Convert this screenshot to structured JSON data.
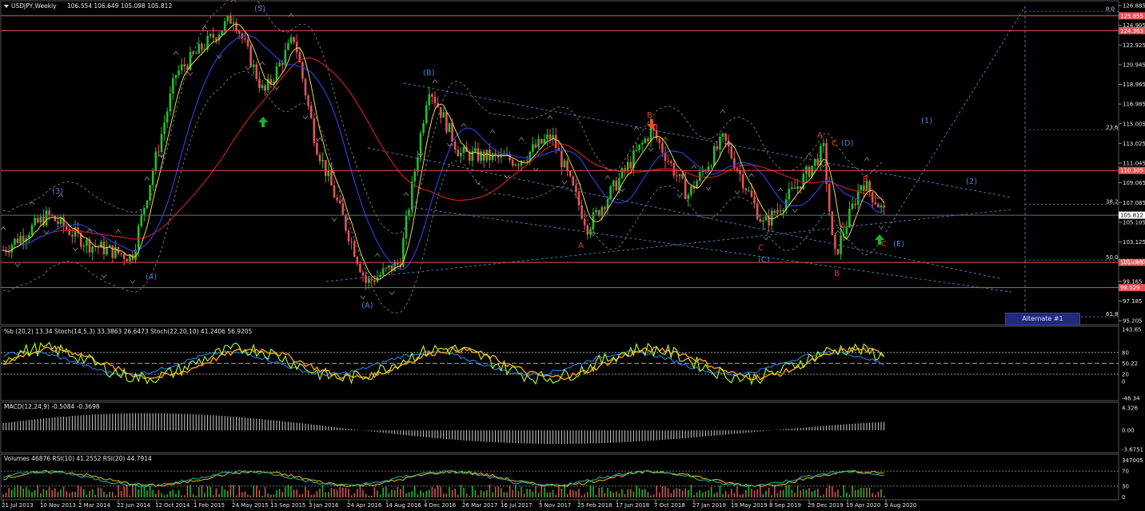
{
  "title": {
    "symbol": "USDJPY,Weekly",
    "ohlc": "106.554 106.649 105.098 105.812"
  },
  "price_axis": [
    "126.885",
    "124.905",
    "122.925",
    "120.945",
    "118.965",
    "116.985",
    "115.005",
    "113.025",
    "111.045",
    "109.065",
    "107.085",
    "105.105",
    "103.125",
    "101.145",
    "99.165",
    "97.185",
    "95.205"
  ],
  "h_levels": [
    {
      "label": "125.855",
      "color": "#e25353",
      "kind": "red"
    },
    {
      "label": "124.363",
      "color": "#e25353",
      "kind": "red"
    },
    {
      "label": "110.305",
      "color": "#e25353",
      "kind": "red"
    },
    {
      "label": "105.812",
      "color": "#6e6e6e",
      "kind": "current"
    },
    {
      "label": "101.063",
      "color": "#e25353",
      "kind": "red"
    },
    {
      "label": "98.529",
      "color": "#e25353",
      "kind": "red"
    }
  ],
  "fib_labels": [
    "0.0",
    "23.6",
    "38.2",
    "50.0",
    "61.8"
  ],
  "date_axis": [
    "21 Jul 2013",
    "10 Nov 2013",
    "2 Mar 2014",
    "22 Jun 2014",
    "12 Oct 2014",
    "1 Feb 2015",
    "24 May 2015",
    "13 Sep 2015",
    "3 Jan 2016",
    "24 Apr 2016",
    "14 Aug 2016",
    "4 Dec 2016",
    "26 Mar 2017",
    "16 Jul 2017",
    "5 Nov 2017",
    "25 Feb 2018",
    "17 Jun 2018",
    "7 Oct 2018",
    "27 Jan 2019",
    "19 May 2019",
    "8 Sep 2019",
    "29 Dec 2019",
    "19 Apr 2020",
    "9 Aug 2020"
  ],
  "wave_labels": [
    {
      "text": "(5)",
      "color": "#4f7fd0"
    },
    {
      "text": "(3)",
      "color": "#4f7fd0"
    },
    {
      "text": "(4)",
      "color": "#4f7fd0"
    },
    {
      "text": "(B)",
      "color": "#4f7fd0"
    },
    {
      "text": "(A)",
      "color": "#4f7fd0"
    },
    {
      "text": "B",
      "color": "#e23b3b"
    },
    {
      "text": "A",
      "color": "#e23b3b"
    },
    {
      "text": "A",
      "color": "#e23b3b"
    },
    {
      "text": "C",
      "color": "#e23b3b"
    },
    {
      "text": "(D)",
      "color": "#4f7fd0"
    },
    {
      "text": "(C)",
      "color": "#4f7fd0"
    },
    {
      "text": "C",
      "color": "#e23b3b"
    },
    {
      "text": "B",
      "color": "#e23b3b"
    },
    {
      "text": "A",
      "color": "#e23b3b"
    },
    {
      "text": "B",
      "color": "#e23b3b"
    },
    {
      "text": "C",
      "color": "#e23b3b"
    },
    {
      "text": "(E)",
      "color": "#4f7fd0"
    },
    {
      "text": "(1)",
      "color": "#4f7fd0"
    },
    {
      "text": "(2)",
      "color": "#4f7fd0"
    }
  ],
  "alternate_label": "Alternate #1",
  "osc_panel": {
    "title": "%b (20,2) 13.34  Stoch(14,5,3) 33.3863 26.6473  Stoch(22,20,10) 41.2406 56.9205",
    "axis": [
      "143.65",
      "80",
      "50.22",
      "20",
      "0",
      "-46.34"
    ]
  },
  "macd_panel": {
    "title": "MACD(12,24,9) -0.5084 -0.3698",
    "axis": [
      "4.326",
      "0.00",
      "-3.6751"
    ]
  },
  "vol_panel": {
    "title": "Volumes 46876  RSI(10) 41.2552  RSI(20) 44.7914",
    "axis": [
      "347005",
      "70",
      "30",
      "0"
    ]
  },
  "colors": {
    "bull": "#22c02a",
    "bear": "#e05555",
    "ma_yellow": "#e8d84a",
    "ma_blue": "#2a3fd6",
    "ma_red": "#c81e1e",
    "stoch_orange": "#ff9d1a",
    "stoch_lime": "#b8ff2a",
    "stoch_blue": "#2a8cff",
    "fib_blue": "#5a7fc0"
  }
}
